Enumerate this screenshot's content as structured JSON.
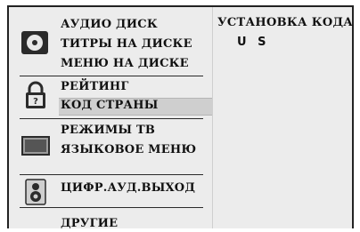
{
  "menu": {
    "group_disc": {
      "icon": "disc-icon",
      "items": [
        "АУДИО ДИСК",
        "ТИТРЫ НА ДИСКЕ",
        "МЕНЮ НА ДИСКЕ"
      ]
    },
    "group_lock": {
      "icon": "padlock-icon",
      "items": [
        "РЕЙТИНГ",
        "КОД СТРАНЫ"
      ],
      "selected": "КОД СТРАНЫ"
    },
    "group_tv": {
      "icon": "tv-screen-icon",
      "items": [
        "РЕЖИМЫ ТВ",
        "ЯЗЫКОВОЕ МЕНЮ"
      ]
    },
    "group_audio": {
      "icon": "speaker-icon",
      "items": [
        "ЦИФР.АУД.ВЫХОД"
      ]
    },
    "group_other": {
      "items": [
        "ДРУГИЕ"
      ]
    }
  },
  "panel": {
    "title": "УСТАНОВКА КОДА",
    "code_chars": [
      "U",
      "S"
    ]
  },
  "colors": {
    "background": "#ececec",
    "highlight": "#cfcfcf",
    "text": "#111111"
  }
}
